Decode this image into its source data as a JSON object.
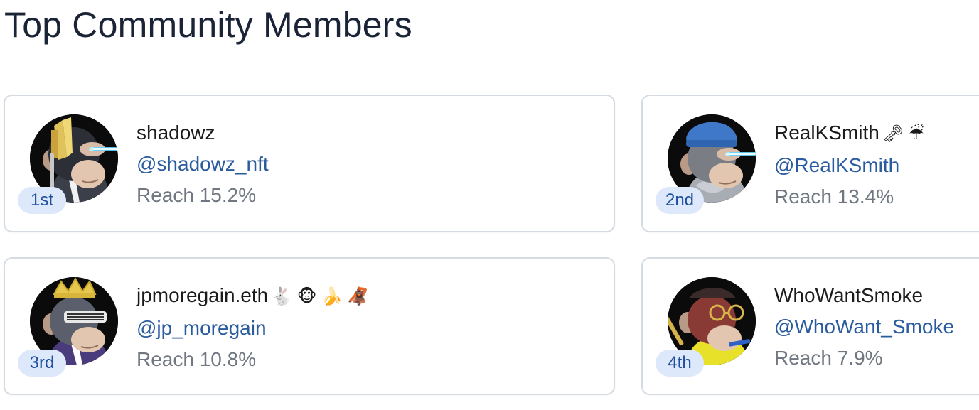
{
  "page": {
    "title": "Top Community Members"
  },
  "members": [
    {
      "rank": "1st",
      "name": "shadowz",
      "name_emoji": "",
      "handle": "@shadowz_nft",
      "reach": "Reach 15.2%",
      "avatar_description": "ape with gold hair and laser eyes"
    },
    {
      "rank": "2nd",
      "name": "RealKSmith",
      "name_emoji": "🗝 ☔",
      "handle": "@RealKSmith",
      "reach": "Reach 13.4%",
      "avatar_description": "ape with blue beanie and laser eyes"
    },
    {
      "rank": "3rd",
      "name": "jpmoregain.eth",
      "name_emoji": "🐇 🐵 🍌 🦧",
      "handle": "@jp_moregain",
      "reach": "Reach 10.8%",
      "avatar_description": "ape with crown and shutter shades"
    },
    {
      "rank": "4th",
      "name": "WhoWantSmoke",
      "name_emoji": "",
      "handle": "@WhoWant_Smoke",
      "reach": "Reach 7.9%",
      "avatar_description": "ape with gold glasses and cigar"
    }
  ],
  "colors": {
    "title": "#1b2437",
    "handle": "#2a5b9e",
    "reach": "#707781",
    "rank_badge_bg": "#dde8fa",
    "rank_badge_text": "#1f4f9e",
    "card_border": "#d5dbe2"
  }
}
